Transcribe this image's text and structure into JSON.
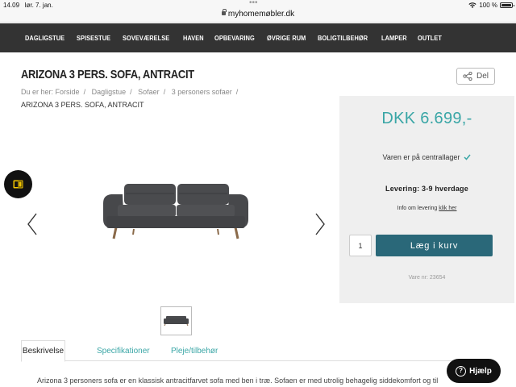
{
  "status_bar": {
    "time": "14.09",
    "date": "lør. 7. jan.",
    "url": "myhomemøbler.dk",
    "battery": "100 %"
  },
  "nav": {
    "items": [
      {
        "label": "DAGLIGSTUE"
      },
      {
        "label": "SPISESTUE"
      },
      {
        "label": "SOVEVÆRELSE"
      },
      {
        "label": "HAVEN"
      },
      {
        "label": "OPBEVARING"
      },
      {
        "label": "ØVRIGE RUM"
      },
      {
        "label": "BOLIGTILBEHØR"
      },
      {
        "label": "LAMPER"
      },
      {
        "label": "OUTLET"
      }
    ]
  },
  "product": {
    "title": "ARIZONA 3 PERS. SOFA, ANTRACIT",
    "share_label": "Del",
    "breadcrumb": {
      "prefix": "Du er her:",
      "items": [
        "Forside",
        "Dagligstue",
        "Sofaer",
        "3 personers sofaer"
      ],
      "current": "ARIZONA 3 PERS. SOFA, ANTRACIT"
    }
  },
  "pricebox": {
    "price": "DKK 6.699,-",
    "stock": "Varen er på centrallager",
    "delivery": "Levering: 3-9 hverdage",
    "delivery_info_text": "Info om levering",
    "delivery_info_link": "klik her",
    "quantity": "1",
    "add_to_cart": "Læg i kurv",
    "item_number": "Vare nr: 23654"
  },
  "tabs": [
    {
      "label": "Beskrivelse"
    },
    {
      "label": "Specifikationer"
    },
    {
      "label": "Pleje/tilbehør"
    }
  ],
  "description": "Arizona 3 personers sofa er en klassisk antracitfarvet sofa med ben i træ. Sofaen er med utrolig behagelig siddekomfort og til",
  "help_label": "Hjælp",
  "colors": {
    "nav_bg": "#333333",
    "accent": "#3aa6a6",
    "cart_button": "#2a6879",
    "float_button_icon": "#f2c500"
  }
}
